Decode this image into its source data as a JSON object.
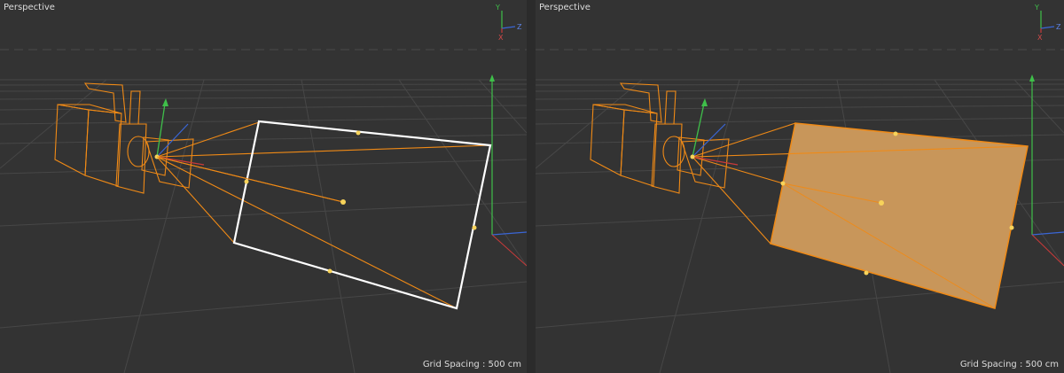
{
  "viewports": [
    {
      "title": "Perspective",
      "grid_spacing": "Grid Spacing : 500 cm",
      "area_light_shading": "wireframe"
    },
    {
      "title": "Perspective",
      "grid_spacing": "Grid Spacing : 500 cm",
      "area_light_shading": "filled"
    }
  ],
  "axis_gizmo": {
    "y": "Y",
    "z": "Z",
    "x": "X"
  },
  "colors": {
    "background": "#333333",
    "grid": "#4a4a4a",
    "object_wire": "#f08a16",
    "light_fill": "#c8965a",
    "handle": "#f7d35a",
    "selection_outline": "#ffffff",
    "axis_y": "#3fbf4a",
    "axis_x": "#c93a3a",
    "axis_z": "#3a66d6"
  }
}
